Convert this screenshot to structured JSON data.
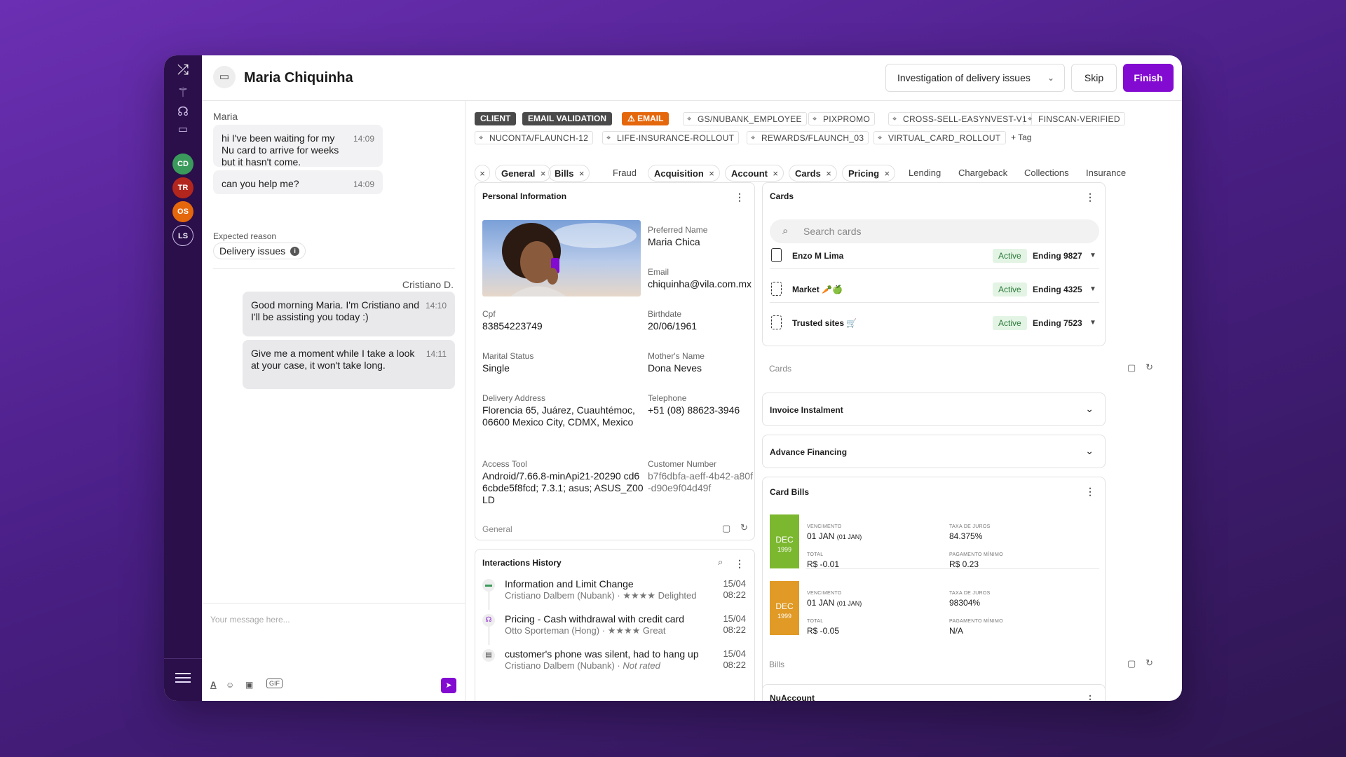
{
  "header": {
    "title": "Maria Chiquinha",
    "reason": "Investigation of delivery issues",
    "skip": "Skip",
    "finish": "Finish"
  },
  "rail": {
    "avatars": [
      {
        "initials": "CD",
        "color": "#3a9a5b"
      },
      {
        "initials": "TR",
        "color": "#b3261e"
      },
      {
        "initials": "OS",
        "color": "#e5670c"
      },
      {
        "initials": "LS",
        "color": "#2a0f4a"
      }
    ]
  },
  "chat": {
    "customer_name": "Maria",
    "customer_messages": [
      {
        "text": "hi I've been waiting for my Nu card to arrive for weeks but it hasn't come.",
        "time": "14:09"
      },
      {
        "text": "can you help me?",
        "time": "14:09"
      }
    ],
    "expected_reason_label": "Expected reason",
    "expected_reason_value": "Delivery issues",
    "agent_name": "Cristiano D.",
    "agent_messages": [
      {
        "text": "Good morning Maria. I'm Cristiano and I'll be assisting you today :)",
        "time": "14:10"
      },
      {
        "text": "Give me a moment while I take a look at your case, it won't take long.",
        "time": "14:11"
      }
    ],
    "composer_placeholder": "Your message here...",
    "gif": "GIF"
  },
  "tags": {
    "row1": [
      "CLIENT",
      "EMAIL VALIDATION",
      "EMAIL",
      "GS/NUBANK_EMPLOYEE",
      "PIXPROMO",
      "CROSS-SELL-EASYNVEST-V1",
      "FINSCAN-VERIFIED"
    ],
    "row2": [
      "NUCONTA/FLAUNCH-12",
      "LIFE-INSURANCE-ROLLOUT",
      "REWARDS/FLAUNCH_03",
      "VIRTUAL_CARD_ROLLOUT"
    ],
    "add": "Tag"
  },
  "filters": {
    "active": [
      "General",
      "Bills",
      "Acquisition",
      "Account",
      "Cards",
      "Pricing"
    ],
    "inactive": [
      "Fraud",
      "Lending",
      "Chargeback",
      "Collections",
      "Insurance"
    ]
  },
  "personal": {
    "title": "Personal Information",
    "preferred_name_label": "Preferred Name",
    "preferred_name": "Maria Chica",
    "email_label": "Email",
    "email": "chiquinha@vila.com.mx",
    "cpf_label": "Cpf",
    "cpf": "83854223749",
    "birthdate_label": "Birthdate",
    "birthdate": "20/06/1961",
    "marital_label": "Marital Status",
    "marital": "Single",
    "mother_label": "Mother's Name",
    "mother": "Dona Neves",
    "address_label": "Delivery Address",
    "address": "Florencia 65, Juárez, Cuauhtémoc, 06600 Mexico City, CDMX, Mexico",
    "phone_label": "Telephone",
    "phone": "+51 (08) 88623-3946",
    "access_label": "Access Tool",
    "access": "Android/7.66.8-minApi21-20290 cd66cbde5f8fcd; 7.3.1; asus; ASUS_Z00LD",
    "customer_label": "Customer Number",
    "customer": "b7f6dbfa-aeff-4b42-a80f-d90e9f04d49f",
    "footer": "General"
  },
  "history": {
    "title": "Interactions History",
    "items": [
      {
        "title": "Information and Limit Change",
        "agent": "Cristiano Dalbem (Nubank)",
        "rating": "★★★★ Delighted",
        "date": "15/04",
        "time": "08:22"
      },
      {
        "title": "Pricing - Cash withdrawal with credit card",
        "agent": "Otto Sporteman (Hong)",
        "rating": "★★★★ Great",
        "date": "15/04",
        "time": "08:22"
      },
      {
        "title": "customer's phone was silent, had to hang up",
        "agent": "Cristiano Dalbem (Nubank)",
        "rating": "Not rated",
        "date": "15/04",
        "time": "08:22"
      }
    ]
  },
  "cards": {
    "title": "Cards",
    "search_placeholder": "Search cards",
    "items": [
      {
        "name": "Enzo M Lima",
        "status": "Active",
        "ending": "Ending 9827"
      },
      {
        "name": "Market 🥕🍏",
        "status": "Active",
        "ending": "Ending 4325"
      },
      {
        "name": "Trusted sites 🛒",
        "status": "Active",
        "ending": "Ending 7523"
      }
    ],
    "footer": "Cards"
  },
  "invoice": {
    "title": "Invoice Instalment"
  },
  "advance": {
    "title": "Advance Financing"
  },
  "bills": {
    "title": "Card Bills",
    "labels": {
      "due": "VENCIMENTO",
      "rate": "TAXA DE JUROS",
      "total": "TOTAL",
      "min": "PAGAMENTO MÍNIMO"
    },
    "items": [
      {
        "month": "DEC",
        "year": "1999",
        "color": "#7cb82f",
        "due": "01 JAN",
        "due_small": "(01 JAN)",
        "rate": "84.375%",
        "total": "R$ -0.01",
        "min": "R$ 0.23"
      },
      {
        "month": "DEC",
        "year": "1999",
        "color": "#e09a25",
        "due": "01 JAN",
        "due_small": "(01 JAN)",
        "rate": "98304%",
        "total": "R$ -0.05",
        "min": "N/A"
      }
    ],
    "footer": "Bills"
  },
  "nuaccount": {
    "title": "NuAccount"
  }
}
